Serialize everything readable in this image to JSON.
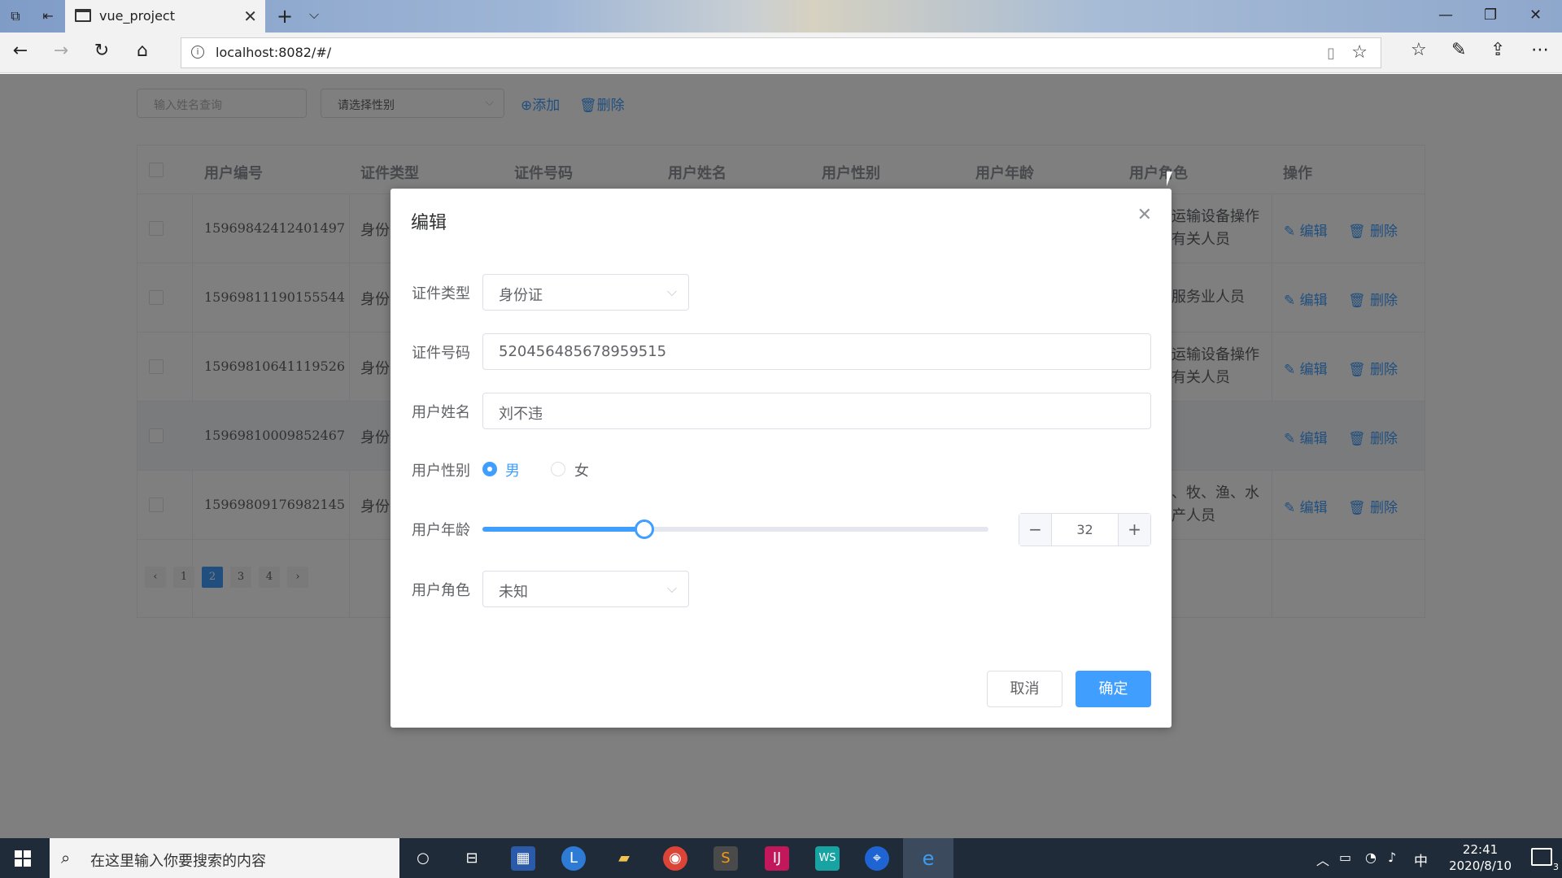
{
  "browser": {
    "tab_title": "vue_project",
    "url": "localhost:8082/#/"
  },
  "toolbar": {
    "search_placeholder": "输入姓名查询",
    "gender_select_placeholder": "请选择性别",
    "add_label": "⊕添加",
    "delete_label": "🗑删除"
  },
  "table": {
    "headers": [
      "用户编号",
      "证件类型",
      "证件号码",
      "用户姓名",
      "用户性别",
      "用户年龄",
      "用户角色",
      "操作"
    ],
    "rows": [
      {
        "id": "15969842412401497",
        "type": "身份",
        "role": "运输设备操作\n有关人员"
      },
      {
        "id": "15969811190155544",
        "type": "身份",
        "role": "服务业人员"
      },
      {
        "id": "15969810641119526",
        "type": "身份",
        "role": "运输设备操作\n有关人员"
      },
      {
        "id": "15969810009852467",
        "type": "身份",
        "role": ""
      },
      {
        "id": "15969809176982145",
        "type": "身份",
        "role": "、牧、渔、水\n产人员"
      }
    ],
    "edit_label": "编辑",
    "delete_label": "删除"
  },
  "pagination": {
    "pages": [
      "1",
      "2",
      "3",
      "4"
    ],
    "current": "2",
    "prev": "‹",
    "next": "›"
  },
  "dialog": {
    "title": "编辑",
    "fields": {
      "id_type_label": "证件类型",
      "id_type_value": "身份证",
      "id_number_label": "证件号码",
      "id_number_value": "520456485678959515",
      "name_label": "用户姓名",
      "name_value": "刘不违",
      "gender_label": "用户性别",
      "gender_male": "男",
      "gender_female": "女",
      "gender_selected": "男",
      "age_label": "用户年龄",
      "age_value": "32",
      "age_slider_fraction": 0.32,
      "role_label": "用户角色",
      "role_value": "未知"
    },
    "cancel_label": "取消",
    "confirm_label": "确定"
  },
  "taskbar": {
    "search_placeholder": "在这里输入你要搜索的内容",
    "ime": "中",
    "time": "22:41",
    "date": "2020/8/10",
    "notifications": "3"
  },
  "colors": {
    "primary": "#409eff",
    "mask": "rgba(0,0,0,0.5)",
    "taskbar": "#1f2b38"
  }
}
